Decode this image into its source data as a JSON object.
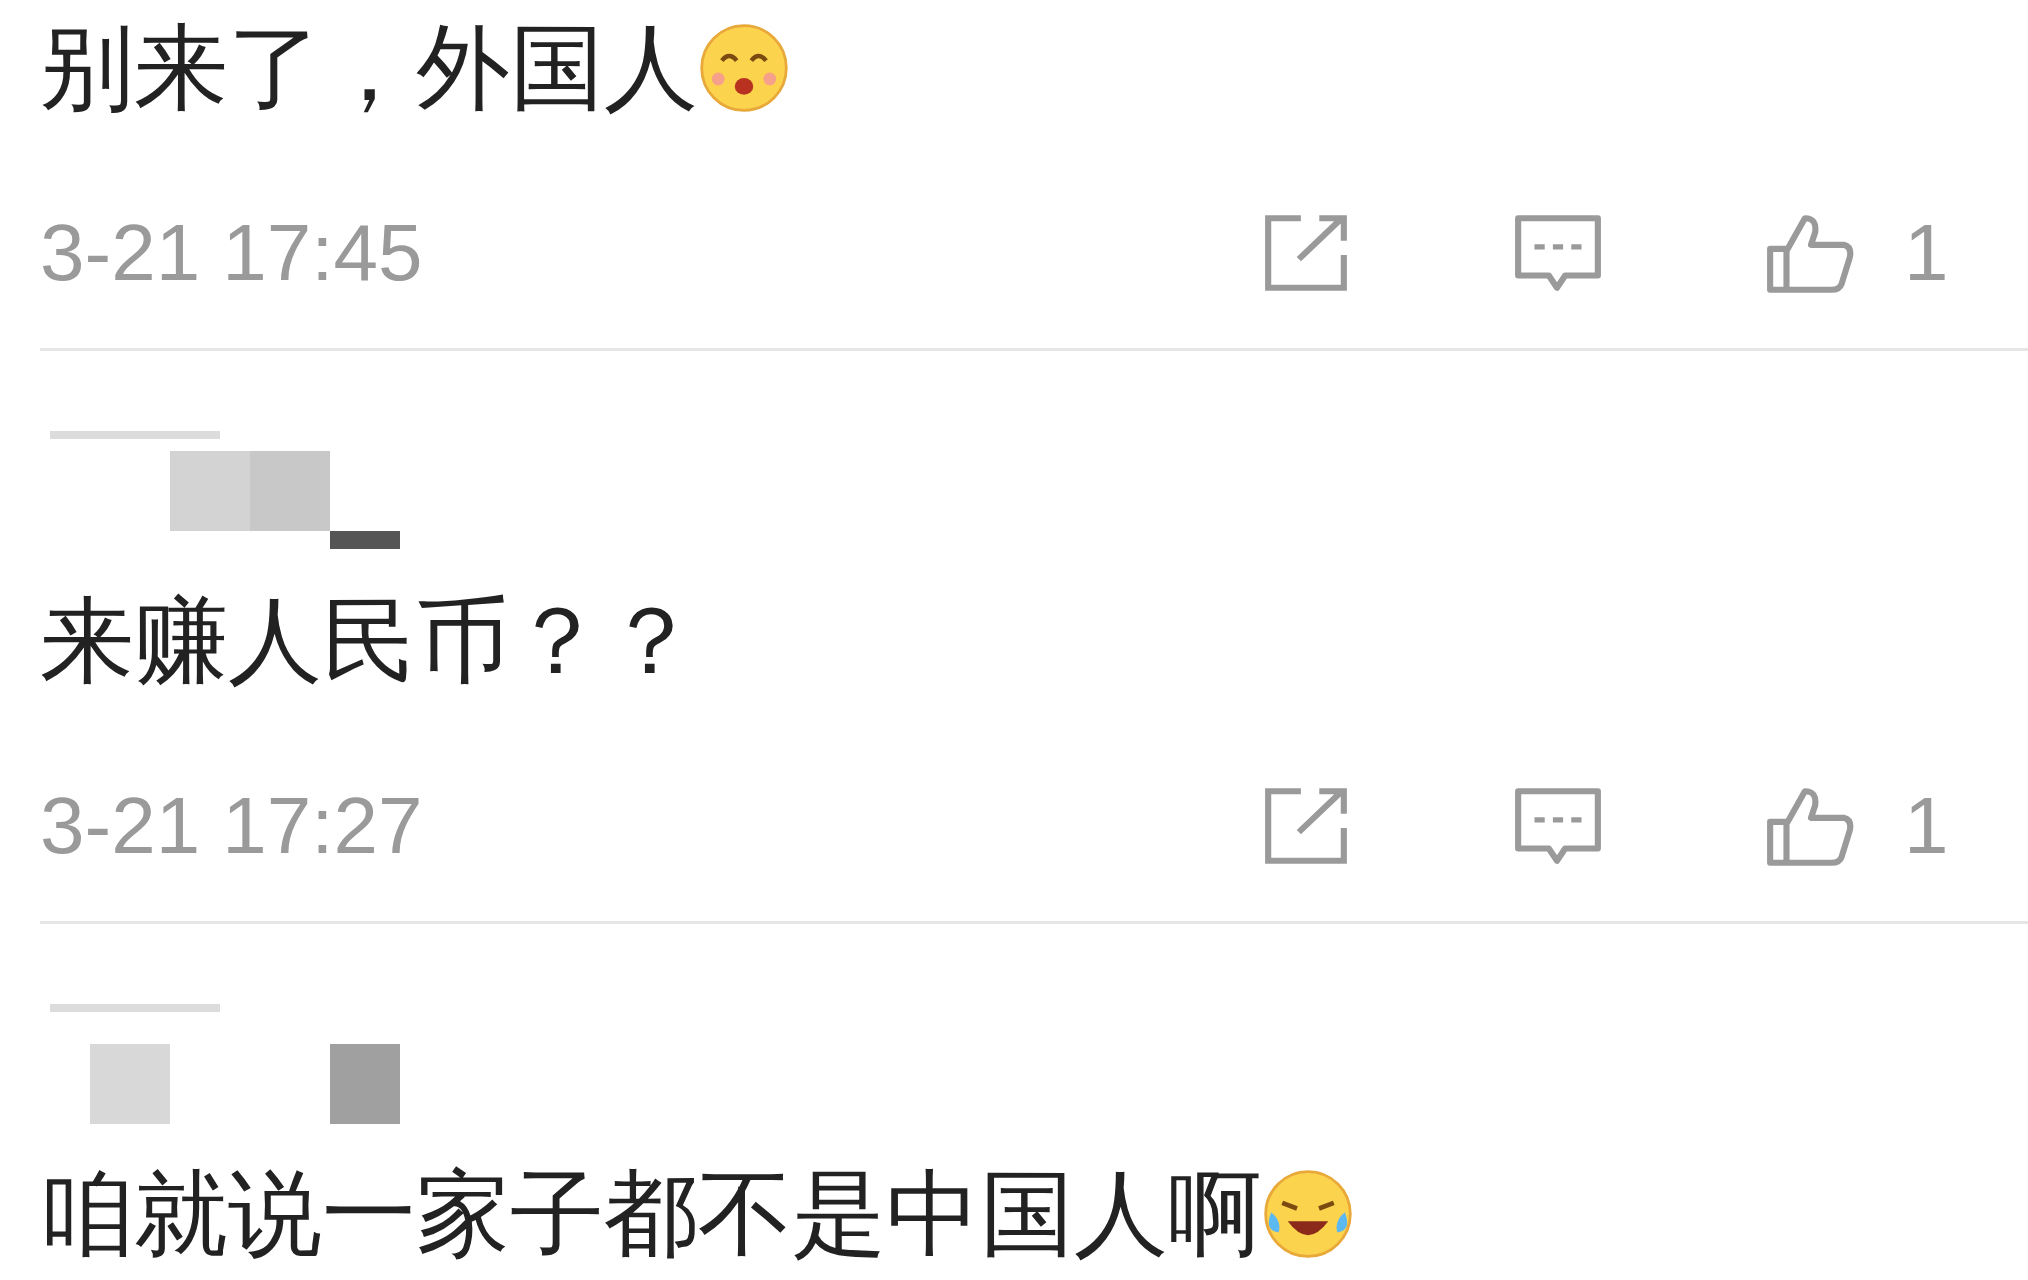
{
  "comments": [
    {
      "kind": "smile-emoji",
      "text": "别来了，外国人",
      "time": "3-21 17:45",
      "likes": "1",
      "show_user": false
    },
    {
      "kind": "plain",
      "text": "来赚人民币？？",
      "time": "3-21 17:27",
      "likes": "1",
      "show_user": true
    },
    {
      "kind": "laugh-emoji",
      "text": "咱就说一家子都不是中国人啊",
      "show_user": true
    }
  ]
}
